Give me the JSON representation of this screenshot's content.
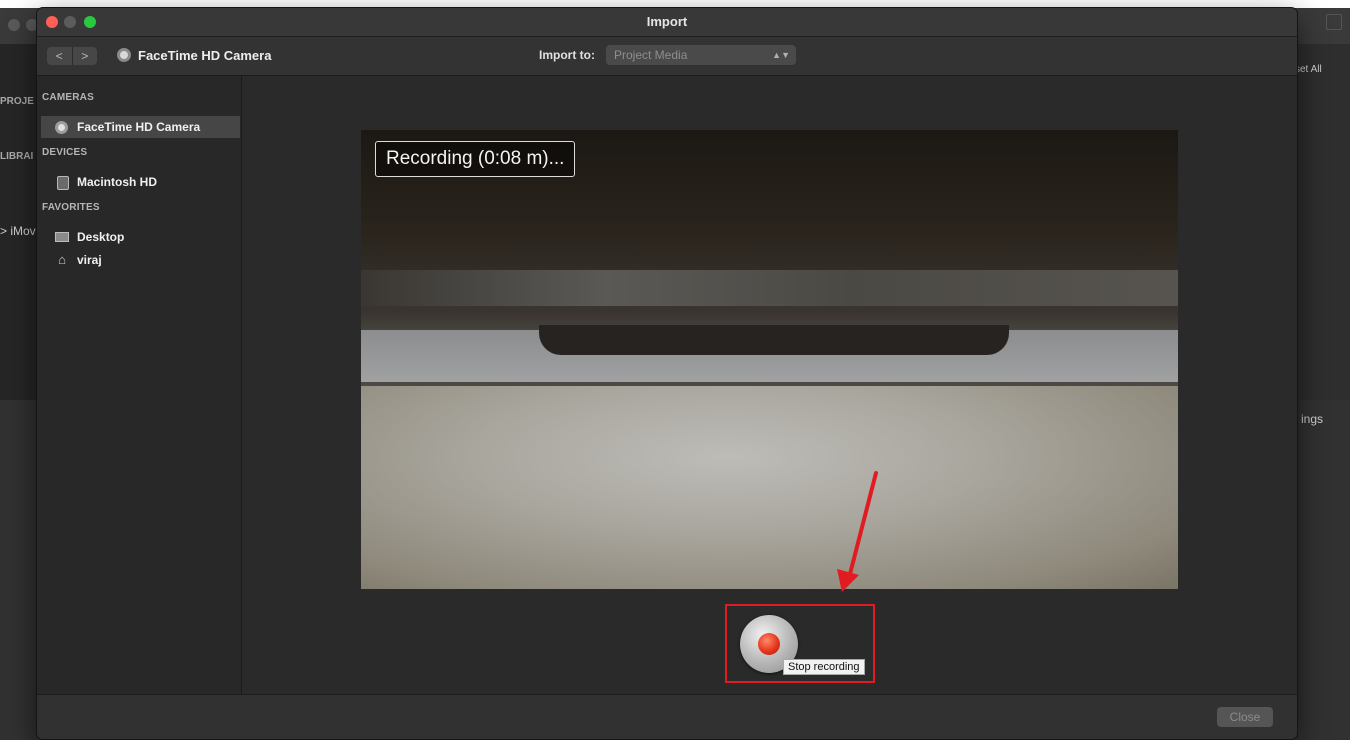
{
  "background_app": {
    "sidebar_labels": [
      "PROJE",
      "LIBRAI",
      "> iMov"
    ],
    "right_labels": [
      "set All",
      "ings"
    ]
  },
  "dialog": {
    "title": "Import",
    "toolbar": {
      "back_glyph": "<",
      "forward_glyph": ">",
      "device_name": "FaceTime HD Camera",
      "import_to_label": "Import to:",
      "import_to_value": "Project Media"
    },
    "sidebar": {
      "sections": [
        {
          "title": "CAMERAS",
          "items": [
            {
              "label": "FaceTime HD Camera",
              "icon": "camera-icon",
              "selected": true
            }
          ]
        },
        {
          "title": "DEVICES",
          "items": [
            {
              "label": "Macintosh HD",
              "icon": "disk-icon",
              "selected": false
            }
          ]
        },
        {
          "title": "FAVORITES",
          "items": [
            {
              "label": "Desktop",
              "icon": "desktop-icon",
              "selected": false
            },
            {
              "label": "viraj",
              "icon": "home-icon",
              "selected": false
            }
          ]
        }
      ]
    },
    "preview": {
      "recording_status": "Recording (0:08 m)..."
    },
    "record_button": {
      "tooltip": "Stop recording",
      "accent_color": "#e11b22"
    },
    "footer": {
      "close_label": "Close"
    }
  }
}
